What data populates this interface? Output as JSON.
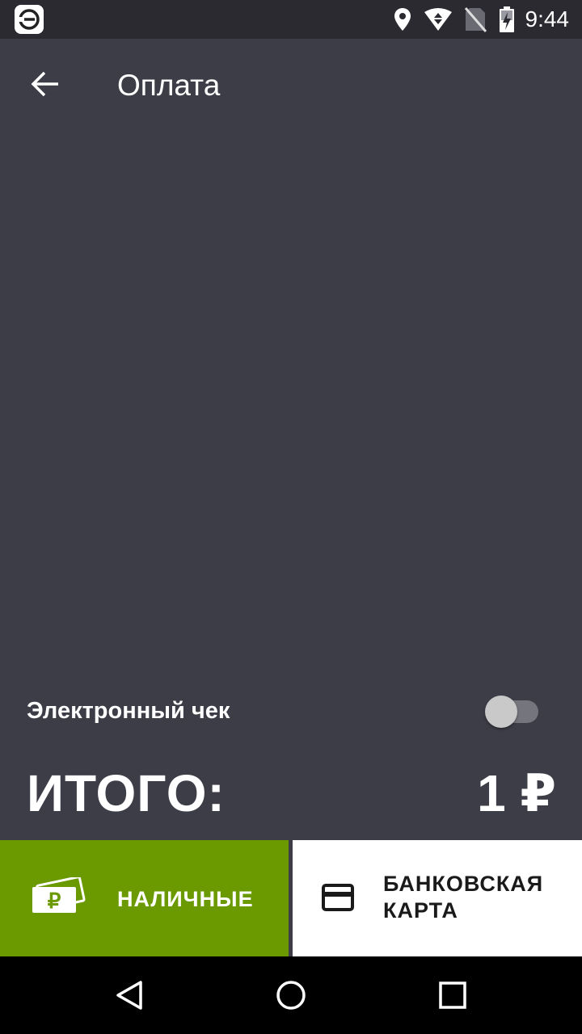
{
  "status_bar": {
    "time": "9:44",
    "icons": [
      "app-badge-icon",
      "location-icon",
      "wifi-icon",
      "no-sim-icon",
      "battery-charging-icon"
    ]
  },
  "app_bar": {
    "title": "Оплата",
    "back_icon": "arrow-back-icon"
  },
  "receipt": {
    "label": "Электронный чек",
    "toggle_on": false
  },
  "total": {
    "label": "ИТОГО:",
    "value": "1 ₽"
  },
  "payment": {
    "cash_label": "НАЛИЧНЫЕ",
    "card_label": "БАНКОВСКАЯ\nКАРТА",
    "cash_color": "#6a9a00",
    "card_color": "#ffffff"
  },
  "nav": {
    "items": [
      "back-triangle-icon",
      "home-circle-icon",
      "recents-square-icon"
    ]
  },
  "colors": {
    "background": "#3d3d47",
    "status_bar": "#2a2a30",
    "accent": "#6a9a00"
  }
}
